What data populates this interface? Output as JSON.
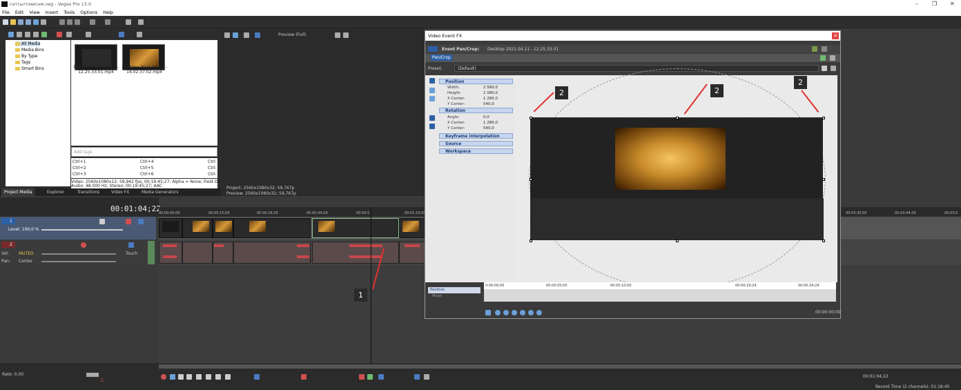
{
  "app": {
    "window_title": "сатсытсмиснм.veg - Vegas Pro 13.0"
  },
  "menu": [
    "File",
    "Edit",
    "View",
    "Insert",
    "Tools",
    "Options",
    "Help"
  ],
  "media_tree": [
    "All Media",
    "Media Bins",
    "By Type",
    "Tags",
    "Smart Bins"
  ],
  "media_items": [
    {
      "caption_line1": "Desktop 2021.04.11 -",
      "caption_line2": "12.25.33.01.mp4"
    },
    {
      "caption_line1": "Desktop 2021.04.11 -",
      "caption_line2": "14.02.37.02.mp4"
    }
  ],
  "tags_placeholder": "Add tags",
  "shortcuts": [
    [
      "Ctrl+1",
      "Ctrl+4",
      "Ctrl-"
    ],
    [
      "Ctrl+2",
      "Ctrl+5",
      "Ctrl-"
    ],
    [
      "Ctrl+3",
      "Ctrl+6",
      "Ctrl-"
    ]
  ],
  "media_info": {
    "line1": "Video: 2560x1080x12; 59,942 fps; 00:19:45;27; Alpha = None; Field Order = No",
    "line2": "Audio: 48.000 Hz; Stereo; 00:19:45;27; AAC"
  },
  "tabs": [
    "Project Media",
    "Explorer",
    "Transitions",
    "Video FX",
    "Media Generators"
  ],
  "preview": {
    "quality": "Preview (Full)",
    "project": "Project:  2560x1080x32; 59,767p",
    "preview": "Preview:  2560x1080x32; 59,767p"
  },
  "timeline": {
    "timecode": "00:01:04;22",
    "ruler_ticks": [
      "00:00:00;00",
      "00:00:15;00",
      "00:00:29;29",
      "00:00:44;29",
      "00:00:5",
      "00:01:15;00",
      "00:03:30;00",
      "00:03:44;29",
      "00:03:5"
    ],
    "track1": {
      "number": "1",
      "level": "Level: 100,0 %"
    },
    "track2": {
      "number": "2",
      "vol_label": "Vol:",
      "vol_value": "MUTED",
      "pan_label": "Pan:",
      "pan_value": "Center",
      "mode": "Touch"
    }
  },
  "bottom": {
    "rate": "Rate: 0,00",
    "time": "00:01:04;22",
    "record_time": "Record Time (2 channels): 01:18:45"
  },
  "fx": {
    "title": "Video Event FX",
    "event_label": "Event Pan/Crop:",
    "event_name": "Desktop 2021.04.11 - 12.25.33.01",
    "chain_button": "Pan/Crop",
    "preset_label": "Preset:",
    "preset_value": "(Default)",
    "groups": {
      "position": "Position",
      "rotation": "Rotation",
      "keyframe": "Keyframe interpolation",
      "source": "Source",
      "workspace": "Workspace"
    },
    "position_props": [
      {
        "name": "Width:",
        "value": "2 560,0"
      },
      {
        "name": "Height:",
        "value": "1 080,0"
      },
      {
        "name": "X Center:",
        "value": "1 280,0"
      },
      {
        "name": "Y Center:",
        "value": "540,0"
      }
    ],
    "rotation_props": [
      {
        "name": "Angle:",
        "value": "0,0"
      },
      {
        "name": "X Center:",
        "value": "1 280,0"
      },
      {
        "name": "Y Center:",
        "value": "540,0"
      }
    ],
    "kf_position": "Position",
    "kf_mask": "Mask",
    "kf_ticks": [
      "0:00:00;00",
      "00:00:05;00",
      "00:00:10;00",
      "00:00:19;29",
      "00:00:24;29"
    ],
    "kf_time": "00:00:00;00"
  },
  "annotations": {
    "badge1": "1",
    "badge2": "2"
  },
  "colors": {
    "accent": "#2c5fa5",
    "annotation_red": "#e2322e",
    "audio_wave": "#c8464a"
  }
}
